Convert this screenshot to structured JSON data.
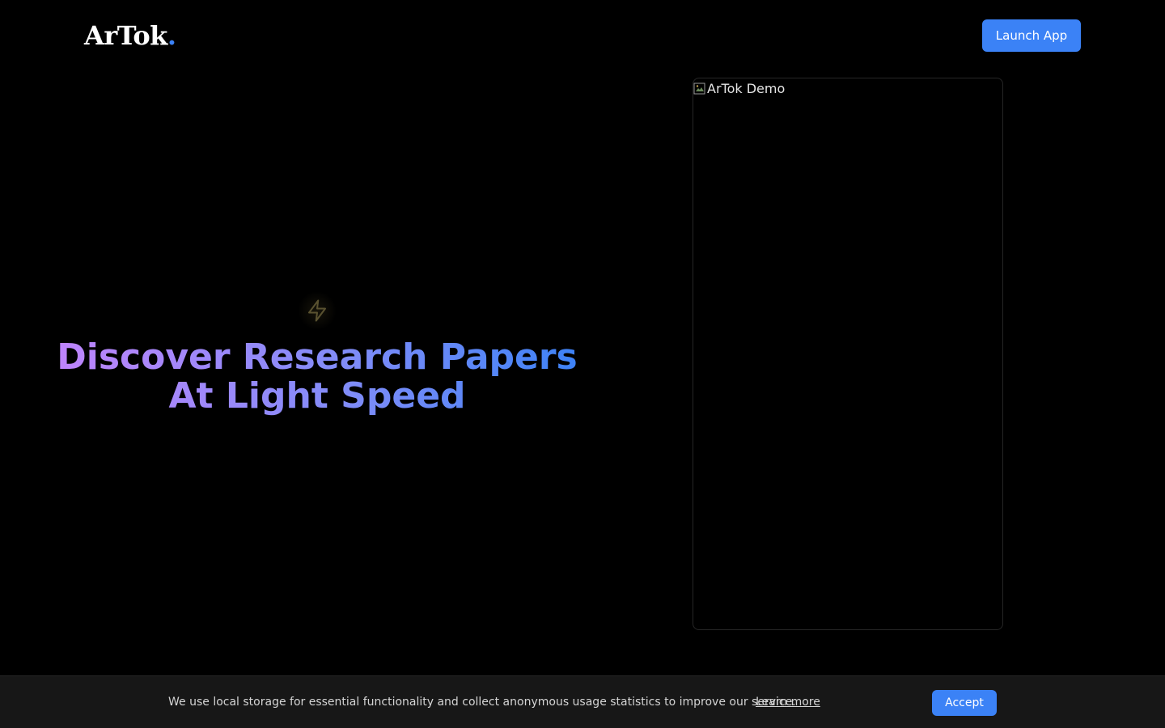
{
  "header": {
    "logo_text": "ArTok",
    "logo_dot": ".",
    "launch_label": "Launch App"
  },
  "hero": {
    "icon": "lightning-bolt-icon",
    "headline_line1": "Discover Research Papers",
    "headline_line2": "At Light Speed"
  },
  "demo": {
    "image_alt": "ArTok Demo"
  },
  "cookie_banner": {
    "message": "We use local storage for essential functionality and collect anonymous usage statistics to improve our service.",
    "learn_more_label": "Learn more",
    "accept_label": "Accept"
  },
  "colors": {
    "accent": "#3b82f6",
    "background": "#000000",
    "banner_bg": "#171717",
    "gradient_start": "#c084fc",
    "gradient_end": "#3b82f6",
    "bolt": "#5a5230"
  }
}
